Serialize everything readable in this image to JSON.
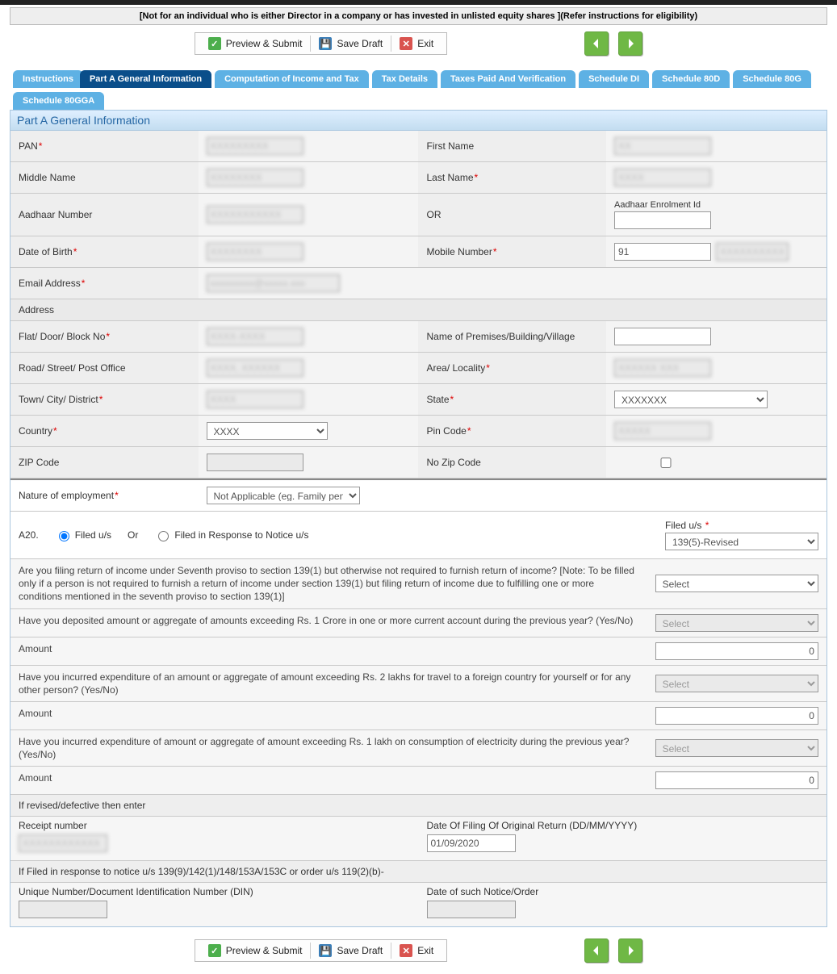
{
  "banner": "[Not for an individual who is either Director in a company or has invested in unlisted equity shares ](Refer instructions for eligibility)",
  "toolbar": {
    "preview": "Preview & Submit",
    "save": "Save Draft",
    "exit": "Exit"
  },
  "tabs": [
    {
      "label": "Instructions",
      "active": false
    },
    {
      "label": "Part A General Information",
      "active": true
    },
    {
      "label": "Computation of Income and Tax",
      "active": false
    },
    {
      "label": "Tax Details",
      "active": false
    },
    {
      "label": "Taxes Paid And Verification",
      "active": false
    },
    {
      "label": "Schedule DI",
      "active": false
    },
    {
      "label": "Schedule 80D",
      "active": false
    },
    {
      "label": "Schedule 80G",
      "active": false
    },
    {
      "label": "Schedule 80GGA",
      "active": false
    }
  ],
  "section_title": "Part A General Information",
  "labels": {
    "pan": "PAN",
    "first_name": "First Name",
    "middle_name": "Middle Name",
    "last_name": "Last Name",
    "aadhaar": "Aadhaar Number",
    "or": "OR",
    "aadhaar_enrol": "Aadhaar Enrolment Id",
    "dob": "Date of Birth",
    "mobile": "Mobile Number",
    "email": "Email Address",
    "address": "Address",
    "flat": "Flat/ Door/ Block No",
    "premises": "Name of Premises/Building/Village",
    "road": "Road/ Street/ Post Office",
    "area": "Area/ Locality",
    "town": "Town/ City/ District",
    "state": "State",
    "country": "Country",
    "pin": "Pin Code",
    "zip": "ZIP Code",
    "nozip": "No Zip Code",
    "nature": "Nature of employment"
  },
  "values": {
    "pan": "XXXXXXXXX",
    "first_name": "XX",
    "middle_name": "XXXXXXXX",
    "last_name": "XXXX",
    "aadhaar": "XXXXXXXXXXX",
    "dob": "XXXXXXXX",
    "mobile_cc": "91",
    "mobile": "XXXXXXXXXX",
    "email": "xxxxxxxxx@xxxxx.xxx",
    "flat": "XXXX-XXXX",
    "road": "XXXX, XXXXXX",
    "area": "XXXXXX XXX",
    "town": "XXXX",
    "state": "XXXXXXX",
    "country": "XXXX",
    "pin": "XXXXX",
    "nature": "Not Applicable (eg. Family pension etc.)"
  },
  "a20": {
    "num": "A20.",
    "opt1": "Filed u/s",
    "or": "Or",
    "opt2": "Filed in Response to Notice u/s",
    "filed_label": "Filed u/s",
    "filed_value": "139(5)-Revised"
  },
  "questions": {
    "q1": "Are you filing return of income under Seventh proviso to section 139(1) but otherwise not required to furnish return of income? [Note: To be filled only if a person is not required to furnish a return of income under section 139(1) but filing return of income due to fulfilling one or more conditions mentioned in the seventh proviso to section 139(1)]",
    "q2": "Have you deposited amount or aggregate of amounts exceeding Rs. 1 Crore in one or more current account during the previous year? (Yes/No)",
    "q3": "Have you incurred expenditure of an amount or aggregate of amount exceeding Rs. 2 lakhs for travel to a foreign country for yourself or for any other person? (Yes/No)",
    "q4": "Have you incurred expenditure of amount or aggregate of amount exceeding Rs. 1 lakh on consumption of electricity during the previous year? (Yes/No)",
    "amount": "Amount",
    "select": "Select",
    "zero": "0",
    "revised_hdr": "If revised/defective then enter",
    "receipt": "Receipt number",
    "receipt_val": "XXXXXXXXXXXX",
    "orig_date_lbl": "Date Of Filing Of Original Return (DD/MM/YYYY)",
    "orig_date_val": "01/09/2020",
    "notice_hdr": "If Filed in response to notice u/s 139(9)/142(1)/148/153A/153C or order u/s 119(2)(b)-",
    "din": "Unique Number/Document Identification Number (DIN)",
    "notice_date": "Date of such Notice/Order"
  }
}
